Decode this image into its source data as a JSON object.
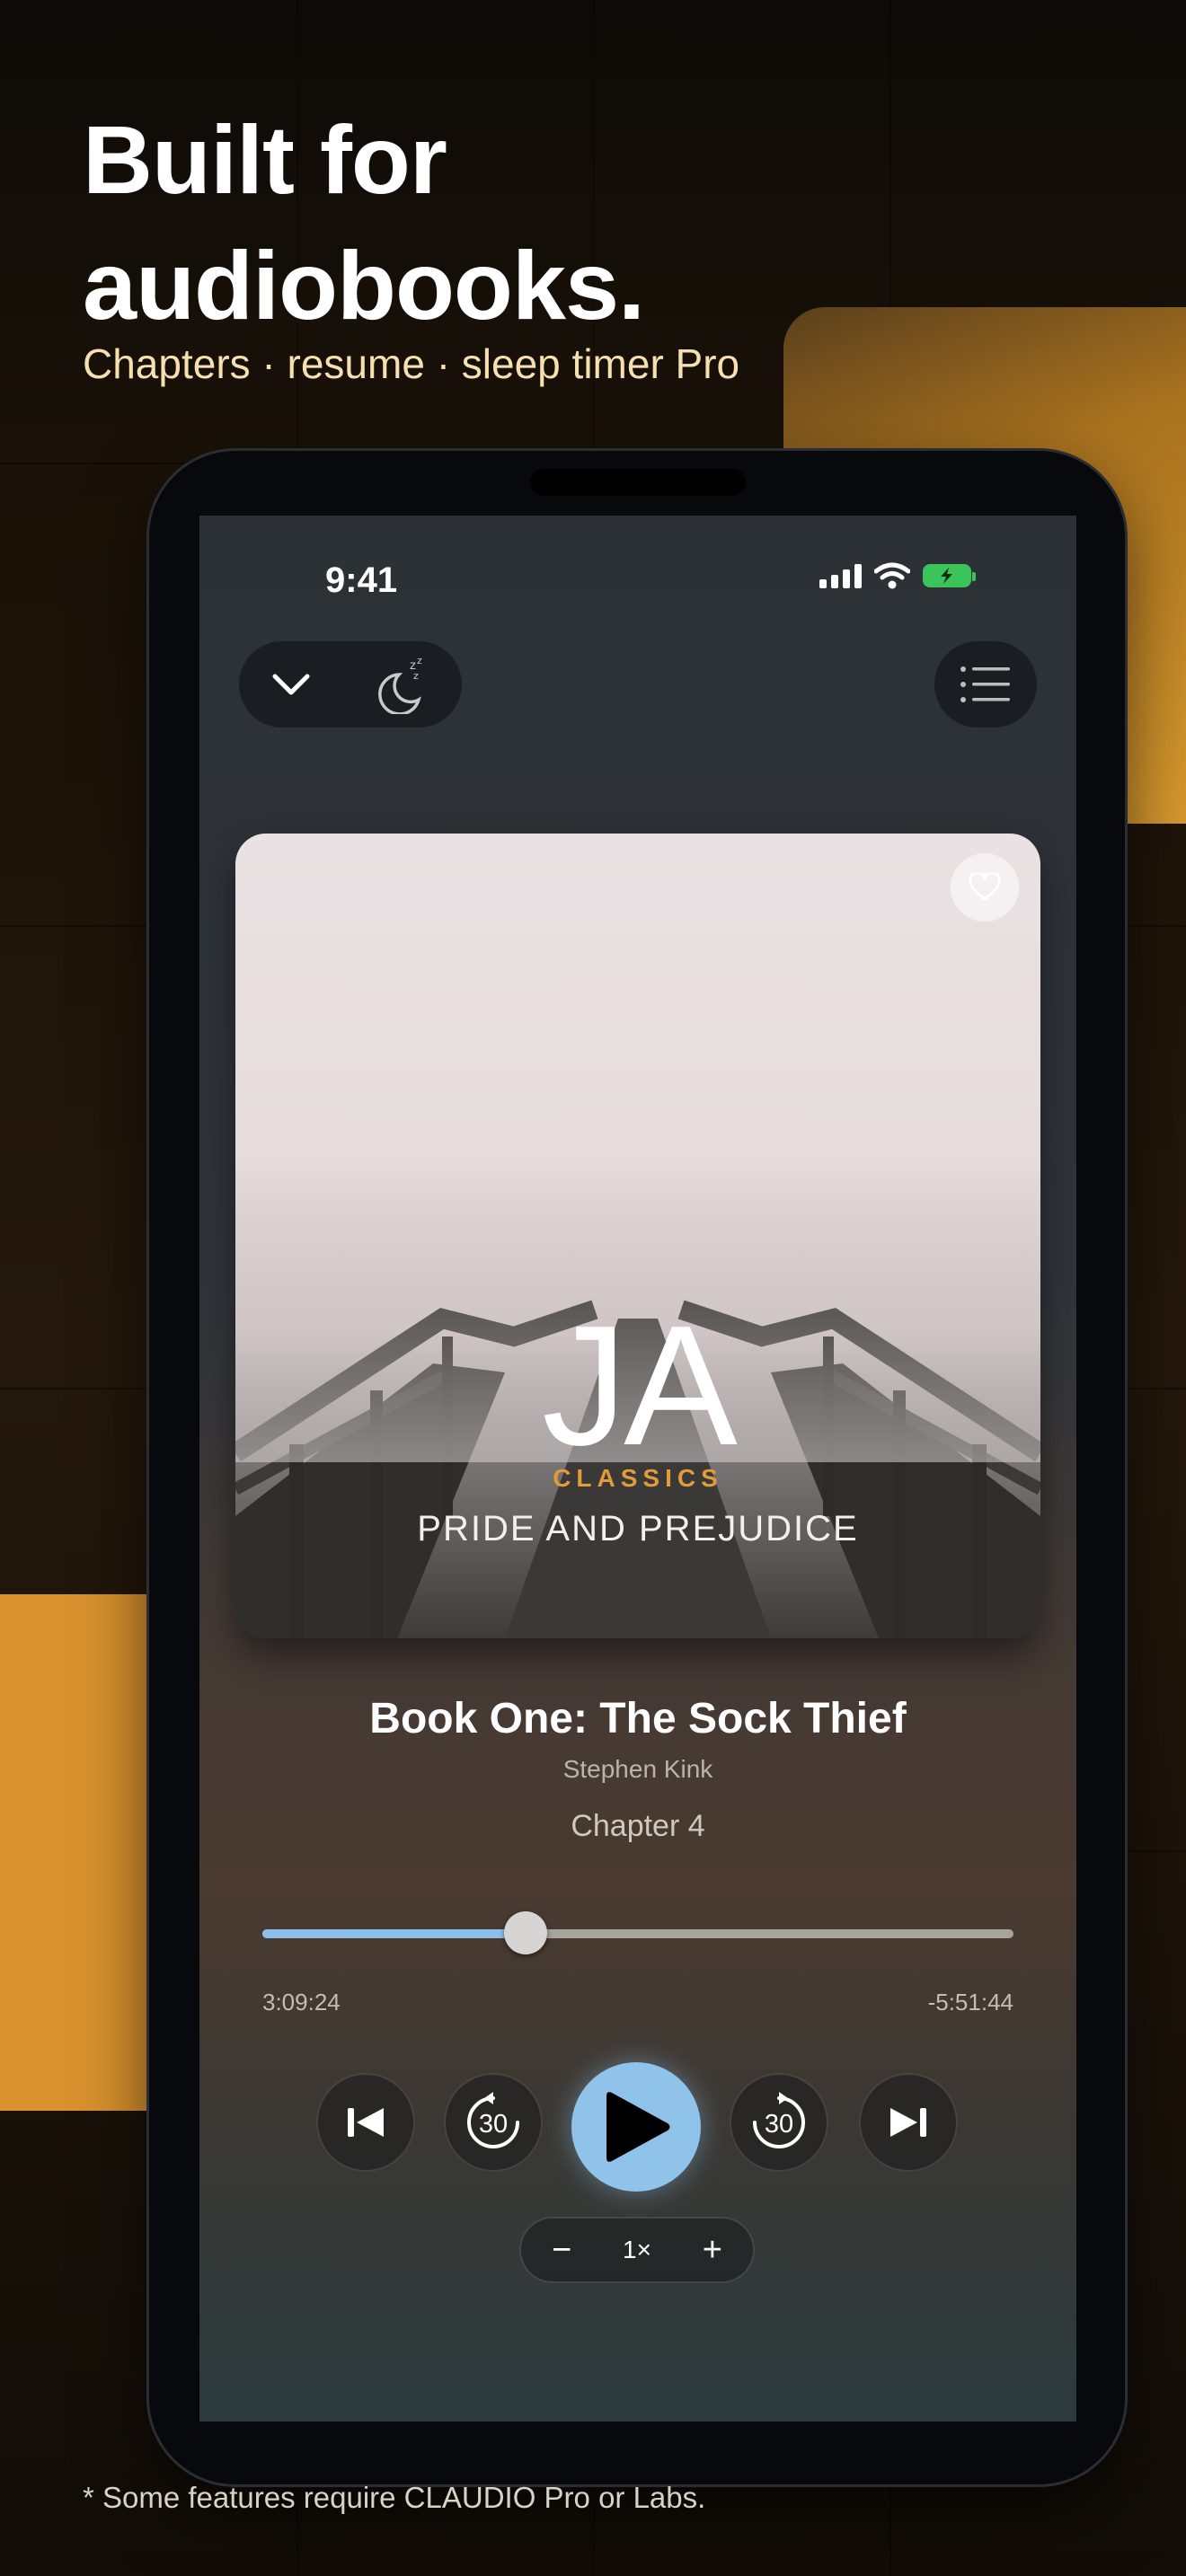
{
  "colors": {
    "accent_amber": "#d9922d",
    "play_button": "#8fc3ea",
    "series_label": "#e09c3a",
    "battery": "#3ac45a"
  },
  "hero": {
    "headline_line1": "Built for",
    "headline_line2": "audiobooks.",
    "subline": "Chapters · resume · sleep timer Pro"
  },
  "status_bar": {
    "time": "9:41",
    "icons": [
      "cellular-signal-icon",
      "wifi-icon",
      "battery-charging-icon"
    ]
  },
  "toolbar": {
    "collapse_icon": "chevron-down-icon",
    "sleep_timer_icon": "moon-zzz-icon",
    "chapters_icon": "list-icon"
  },
  "cover": {
    "initials": "JA",
    "series": "CLASSICS",
    "title": "PRIDE AND PREJUDICE",
    "favorite_icon": "heart-icon"
  },
  "now_playing": {
    "title": "Book One: The Sock Thief",
    "author": "Stephen Kink",
    "chapter": "Chapter 4"
  },
  "progress": {
    "fraction": 0.35,
    "elapsed": "3:09:24",
    "remaining": "-5:51:44"
  },
  "controls": {
    "skip_back_seconds": "30",
    "skip_forward_seconds": "30"
  },
  "speed": {
    "minus": "−",
    "value": "1×",
    "plus": "+"
  },
  "footnote": "* Some features require CLAUDIO Pro or Labs."
}
